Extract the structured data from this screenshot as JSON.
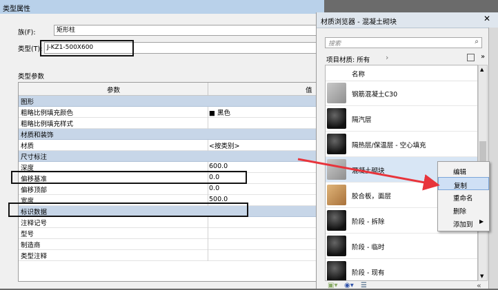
{
  "type_properties": {
    "title": "类型属性",
    "family_label": "族(F):",
    "family_value": "矩形柱",
    "type_label": "类型(T):",
    "type_value": "J-KZ1-500X600",
    "type_params_label": "类型参数",
    "col_param": "参数",
    "col_value": "值",
    "rows": [
      {
        "kind": "group",
        "param": "图形"
      },
      {
        "kind": "item",
        "param": "粗略比例填充颜色",
        "value": "■ 黑色"
      },
      {
        "kind": "item",
        "param": "粗略比例填充样式",
        "value": ""
      },
      {
        "kind": "group",
        "param": "材质和装饰"
      },
      {
        "kind": "item",
        "param": "材质",
        "value": "<按类别>"
      },
      {
        "kind": "group",
        "param": "尺寸标注"
      },
      {
        "kind": "item",
        "param": "深度",
        "value": "600.0"
      },
      {
        "kind": "item",
        "param": "偏移基准",
        "value": "0.0"
      },
      {
        "kind": "item",
        "param": "偏移顶部",
        "value": "0.0"
      },
      {
        "kind": "item",
        "param": "宽度",
        "value": "500.0"
      },
      {
        "kind": "group",
        "param": "标识数据"
      },
      {
        "kind": "item",
        "param": "注释记号",
        "value": ""
      },
      {
        "kind": "item",
        "param": "型号",
        "value": ""
      },
      {
        "kind": "item",
        "param": "制造商",
        "value": ""
      },
      {
        "kind": "item",
        "param": "类型注释",
        "value": ""
      }
    ]
  },
  "material_browser": {
    "title": "材质浏览器 - 混凝土砌块",
    "search_placeholder": "搜索",
    "filter_label": "项目材质: 所有",
    "col_name": "名称",
    "materials": [
      {
        "name": "钢筋混凝土C30",
        "thumb": "concrete"
      },
      {
        "name": "隔汽层",
        "thumb": "dark"
      },
      {
        "name": "隔热层/保温层 - 空心填充",
        "thumb": "dark"
      },
      {
        "name": "混凝土砌块",
        "thumb": "concrete",
        "selected": true
      },
      {
        "name": "胶合板，面层",
        "thumb": "wood"
      },
      {
        "name": "阶段 - 拆除",
        "thumb": "dark"
      },
      {
        "name": "阶段 - 临时",
        "thumb": "dark"
      },
      {
        "name": "阶段 - 现有",
        "thumb": "dark"
      }
    ]
  },
  "context_menu": {
    "items": [
      "编辑",
      "复制",
      "重命名",
      "删除",
      "添加到"
    ],
    "active_index": 1
  },
  "colors": {
    "title_bar": "#b9d1ea",
    "group_row": "#c7d6e8",
    "selection": "#d8e6f5",
    "arrow": "#e8343b"
  }
}
